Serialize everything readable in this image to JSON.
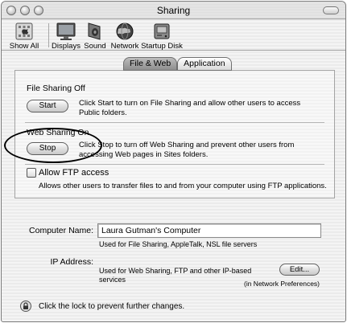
{
  "window": {
    "title": "Sharing"
  },
  "toolbar": {
    "items": [
      {
        "label": "Show All",
        "icon": "apple-grid-icon"
      },
      {
        "label": "Displays",
        "icon": "display-monitor-icon"
      },
      {
        "label": "Sound",
        "icon": "speaker-icon"
      },
      {
        "label": "Network",
        "icon": "globe-icon"
      },
      {
        "label": "Startup Disk",
        "icon": "hard-disk-icon"
      }
    ]
  },
  "tabs": [
    {
      "label": "File & Web",
      "selected": true
    },
    {
      "label": "Application",
      "selected": false
    }
  ],
  "file_sharing": {
    "title": "File Sharing Off",
    "button": "Start",
    "description_line1": "Click Start to turn on File Sharing and allow other users to access",
    "description_line2": "Public folders."
  },
  "web_sharing": {
    "title": "Web Sharing On",
    "button": "Stop",
    "description_line1": "Click Stop to turn off Web Sharing and prevent other users from",
    "description_line2": "accessing Web pages in Sites folders."
  },
  "ftp": {
    "label": "Allow FTP access",
    "checked": false,
    "description": "Allows other users to transfer files to and from your computer using FTP applications."
  },
  "computer_name": {
    "label": "Computer Name:",
    "value": "Laura Gutman's Computer",
    "note": "Used for File Sharing, AppleTalk, NSL file servers"
  },
  "ip_address": {
    "label": "IP Address:",
    "note_line1": "Used for Web Sharing, FTP and other IP-based",
    "note_line2": "services",
    "edit_button": "Edit...",
    "edit_note": "(in Network Preferences)"
  },
  "lock": {
    "text": "Click the lock to prevent further changes."
  }
}
